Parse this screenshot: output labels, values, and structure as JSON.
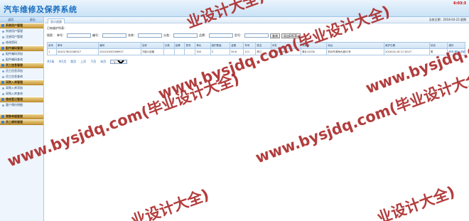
{
  "header": {
    "title": "汽车维修及保养系统",
    "clock": "6:03:3"
  },
  "sidebar": {
    "top": [
      "返回",
      "退出"
    ],
    "groups": [
      {
        "label": "系统用户管理",
        "items": [
          "系统用户管理",
          "注册用户管理",
          "修改密码"
        ]
      },
      {
        "label": "配件编码管理",
        "items": [
          "配件编码添加",
          "配件编码查询"
        ]
      },
      {
        "label": "员工信息管理",
        "items": [
          "员工信息添加",
          "员工信息查询"
        ]
      },
      {
        "label": "采购入库管理",
        "items": [
          "采购入库添加",
          "采购入库查询"
        ]
      },
      {
        "label": "维修登记管理",
        "items": [
          "客户预约明细"
        ]
      },
      {
        "label": "销售单据管理",
        "items": []
      },
      {
        "label": "员工绩效管理",
        "items": []
      }
    ]
  },
  "main": {
    "tab": "显示追面",
    "date": "当前日期：2018-04-23 星期",
    "section_title": "已有维护列表：",
    "search": {
      "labels": [
        "搜索：",
        "单号：",
        "编号：",
        "名称：",
        "分类：",
        "品牌：",
        "型号："
      ],
      "query_button": "查询",
      "export_button": "导出EXCEL"
    },
    "table": {
      "headers": [
        "序号",
        "单号",
        "编号",
        "名称",
        "分类",
        "品牌",
        "型号",
        "单价",
        "维护数量",
        "金额",
        "车号",
        "姓名",
        "手机",
        "车牌号",
        "地址",
        "维护日期",
        "状态",
        "操作"
      ],
      "rows": [
        [
          "1",
          "041017802168317",
          "041010002368937",
          "万能小皮套",
          "",
          "",
          "",
          "300",
          "3",
          "90.6",
          "111",
          "商江",
          "15831356680",
          "粤B-0223k",
          "杭州市滨海大道52号",
          "2018-04-16 17:16:27",
          "是",
          "修改 删除 详细"
        ]
      ]
    },
    "pager": {
      "items": [
        "共1条",
        "共1页",
        "首页",
        "上页",
        "下页",
        "末页"
      ],
      "page_select": "1"
    }
  },
  "watermarks": [
    "www.bysjdq.com(毕业设计大全)",
    "www.bysjdq.com(毕业设计大全)",
    "www.bysjdq.com(毕业设计大全)",
    "www.bysjdq.com(毕业设计大全)",
    "业设计大全)",
    "业设计大全)",
    "业设计大全)"
  ]
}
